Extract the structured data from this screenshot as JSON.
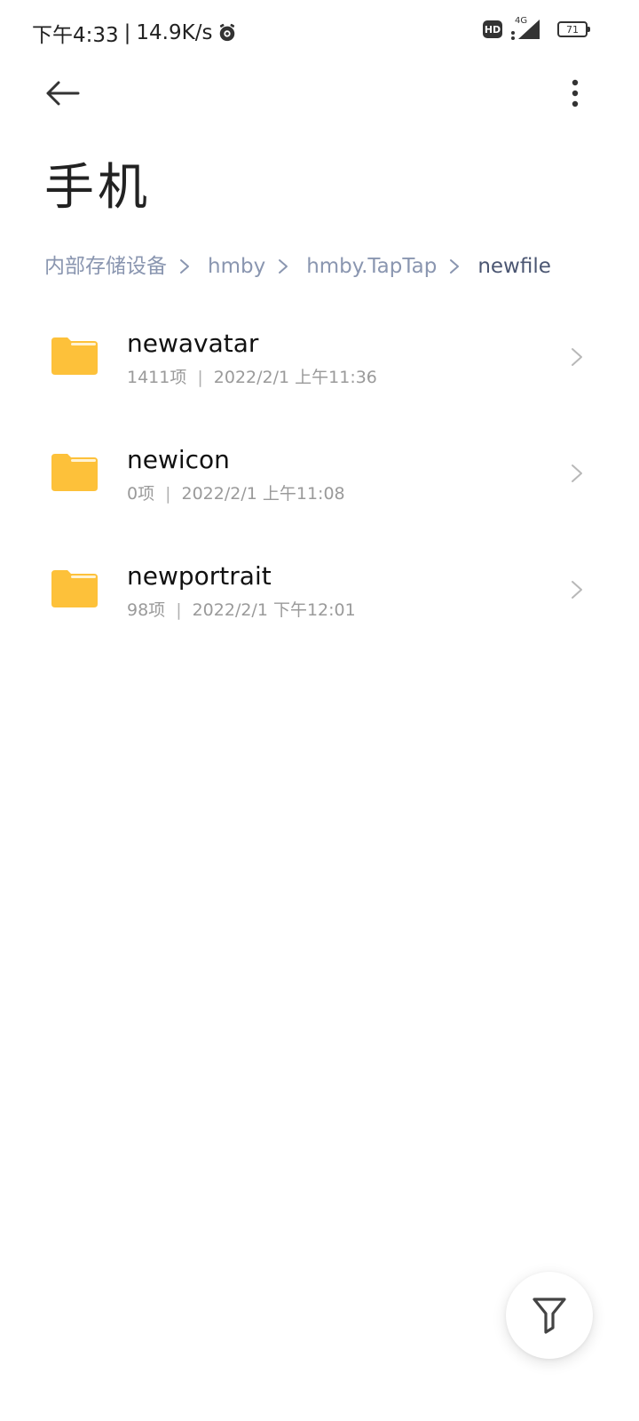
{
  "status_bar": {
    "time": "下午4:33",
    "separator": "|",
    "speed": "14.9K/s",
    "network": "4G",
    "battery": "71"
  },
  "header": {
    "title": "手机"
  },
  "breadcrumb": [
    "内部存储设备",
    "hmby",
    "hmby.TapTap",
    "newfile"
  ],
  "files": [
    {
      "name": "newavatar",
      "count": "1411项",
      "date": "2022/2/1 上午11:36"
    },
    {
      "name": "newicon",
      "count": "0项",
      "date": "2022/2/1 上午11:08"
    },
    {
      "name": "newportrait",
      "count": "98项",
      "date": "2022/2/1 下午12:01"
    }
  ],
  "meta_separator": "|",
  "colors": {
    "folder": "#FDC13A",
    "breadcrumb": "#8A96B0",
    "breadcrumb_current": "#4B5672"
  },
  "icons": {
    "back": "arrow-left",
    "more": "vertical-dots",
    "folder": "folder",
    "chevron": "chevron-right",
    "filter": "funnel"
  }
}
